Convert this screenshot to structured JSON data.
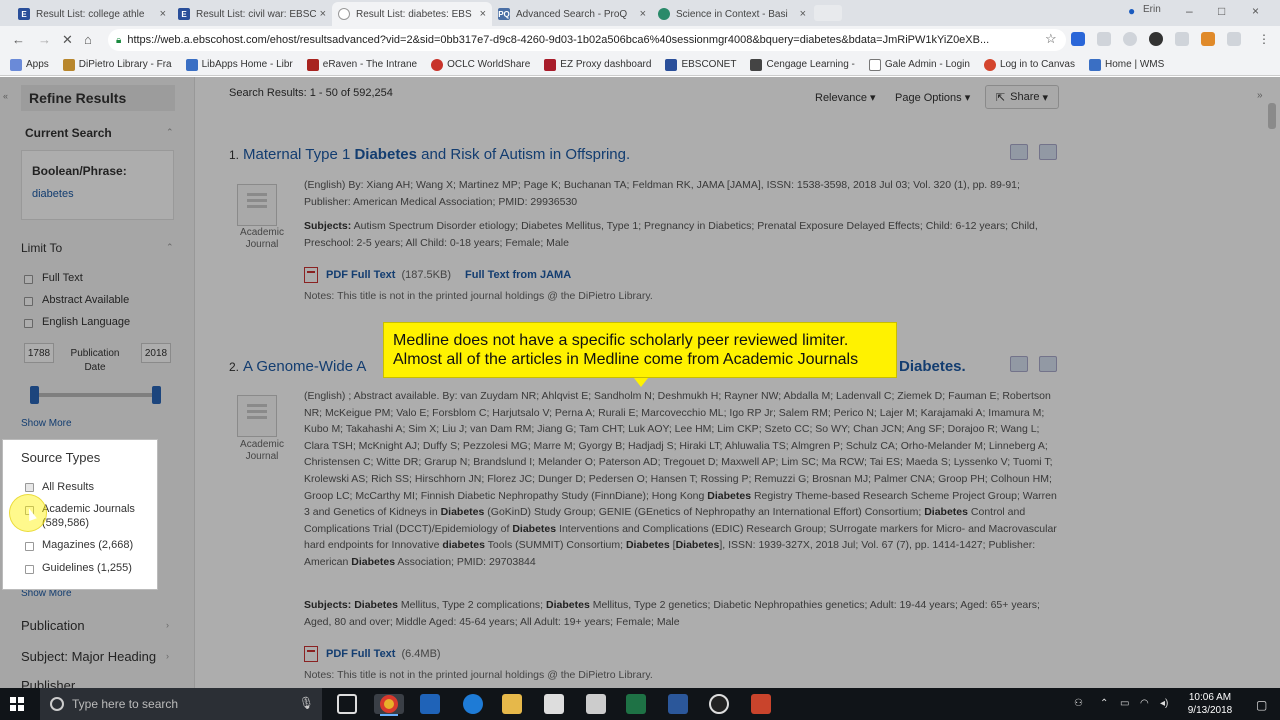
{
  "browser": {
    "tabs": [
      {
        "title": "Result List: college athle",
        "icon": "ebsco-icon",
        "color": "#2a4f9a",
        "active": false
      },
      {
        "title": "Result List: civil war: EBSC",
        "icon": "ebsco-icon",
        "color": "#2a4f9a",
        "active": false
      },
      {
        "title": "Result List: diabetes: EBS",
        "icon": "loading-icon",
        "color": "#888888",
        "active": true
      },
      {
        "title": "Advanced Search - ProQ",
        "icon": "proquest-icon",
        "color": "#4a6fa5",
        "active": false
      },
      {
        "title": "Science in Context - Basi",
        "icon": "gale-icon",
        "color": "#2a8a6a",
        "active": false
      }
    ],
    "user_label": "Erin",
    "url": "https://web.a.ebscohost.com/ehost/resultsadvanced?vid=2&sid=0bb317e7-d9c8-4260-9d03-1b02a506bca6%40sessionmgr4008&bquery=diabetes&bdata=JmRiPW1kYiZ0eXB..."
  },
  "bookmarks": [
    {
      "label": "Apps",
      "color": "#6a8ad8"
    },
    {
      "label": "DiPietro Library - Fra",
      "color": "#b8862c"
    },
    {
      "label": "LibApps Home - Libr",
      "color": "#3a6fc4"
    },
    {
      "label": "eRaven - The Intrane",
      "color": "#a8231f"
    },
    {
      "label": "OCLC WorldShare",
      "color": "#c8332a"
    },
    {
      "label": "EZ Proxy dashboard",
      "color": "#a81c2a"
    },
    {
      "label": "EBSCONET",
      "color": "#2a4f9a"
    },
    {
      "label": "Cengage Learning - ",
      "color": "#444444"
    },
    {
      "label": "Gale Admin - Login",
      "color": "#777777"
    },
    {
      "label": "Log in to Canvas",
      "color": "#d4452d"
    },
    {
      "label": "Home | WMS",
      "color": "#3a6fc4"
    }
  ],
  "sidebar": {
    "refine_title": "Refine Results",
    "current_search": "Current Search",
    "boolean_label": "Boolean/Phrase:",
    "boolean_value": "diabetes",
    "limit_to": "Limit To",
    "limiters": [
      "Full Text",
      "Abstract Available",
      "English Language"
    ],
    "year_from": "1788",
    "year_to": "2018",
    "pub_date_label": "Publication Date",
    "show_more": "Show More",
    "show_more_2": "Show More",
    "publication": "Publication",
    "subject_major": "Subject: Major Heading",
    "publisher": "Publisher"
  },
  "source_types": {
    "title": "Source Types",
    "items": [
      {
        "label": "All Results"
      },
      {
        "label": "Academic Journals (589,586)"
      },
      {
        "label": "Magazines (2,668)"
      },
      {
        "label": "Guidelines (1,255)"
      }
    ]
  },
  "results_header": {
    "count": "Search Results: 1 - 50 of 592,254",
    "relevance": "Relevance",
    "page_options": "Page Options",
    "share": "Share"
  },
  "results": [
    {
      "num": "1.",
      "title_before": "Maternal Type 1 ",
      "title_bold": "Diabetes",
      "title_after": " and Risk of Autism in Offspring.",
      "doctype": "Academic Journal",
      "citation": "(English) By: Xiang AH; Wang X; Martinez MP; Page K; Buchanan TA; Feldman RK, JAMA [JAMA], ISSN: 1538-3598, 2018 Jul 03; Vol. 320 (1), pp. 89-91; Publisher: American Medical Association; PMID: 29936530",
      "subjects_label": "Subjects:",
      "subjects": "Autism Spectrum Disorder etiology; Diabetes Mellitus, Type 1; Pregnancy in Diabetics; Prenatal Exposure Delayed Effects; Child: 6-12 years; Child, Preschool: 2-5 years; All Child: 0-18 years; Female; Male",
      "pdf_link": "PDF Full Text",
      "pdf_size": "(187.5KB)",
      "extra_link": "Full Text from JAMA",
      "notes": "Notes:  This title is not in the printed journal holdings @ the DiPietro Library."
    },
    {
      "num": "2.",
      "title_before": "A Genome-Wide A",
      "title_bold": "Diabetes.",
      "title_after": "",
      "doctype": "Academic Journal",
      "citation": "(English) ; Abstract available. By: van Zuydam NR; Ahlqvist E; Sandholm N; Deshmukh H; Rayner NW; Abdalla M; Ladenvall C; Ziemek D; Fauman E; Robertson NR; McKeigue PM; Valo E; Forsblom C; Harjutsalo V; Perna A; Rurali E; Marcovecchio ML; Igo RP Jr; Salem RM; Perico N; Lajer M; Karajamaki A; Imamura M; Kubo M; Takahashi A; Sim X; Liu J; van Dam RM; Jiang G; Tam CHT; Luk AOY; Lee HM; Lim CKP; Szeto CC; So WY; Chan JCN; Ang SF; Dorajoo R; Wang L; Clara TSH; McKnight AJ; Duffy S; Pezzolesi MG; Marre M; Gyorgy B; Hadjadj S; Hiraki LT; Ahluwalia TS; Almgren P; Schulz CA; Orho-Melander M; Linneberg A; Christensen C; Witte DR; Grarup N; Brandslund I; Melander O; Paterson AD; Tregouet D; Maxwell AP; Lim SC; Ma RCW; Tai ES; Maeda S; Lyssenko V; Tuomi T; Krolewski AS; Rich SS; Hirschhorn JN; Florez JC; Dunger D; Pedersen O; Hansen T; Rossing P; Remuzzi G; Brosnan MJ; Palmer CNA; Groop PH; Colhoun HM; Groop LC; McCarthy MI; Finnish Diabetic Nephropathy Study (FinnDiane); Hong Kong ",
      "citation_b1": "Diabetes",
      "citation_2": " Registry Theme-based Research Scheme Project Group; Warren 3 and Genetics of Kidneys in ",
      "citation_b2": "Diabetes",
      "citation_3": " (GoKinD) Study Group; GENIE (GEnetics of Nephropathy an International Effort) Consortium; ",
      "citation_b3": "Diabetes",
      "citation_4": " Control and Complications Trial (DCCT)/Epidemiology of ",
      "citation_b4": "Diabetes",
      "citation_5": " Interventions and Complications (EDIC) Research Group; SUrrogate markers for Micro- and Macrovascular hard endpoints for Innovative ",
      "citation_b5": "diabetes",
      "citation_6": " Tools (SUMMIT) Consortium; ",
      "citation_b6": "Diabetes",
      "citation_7": " [",
      "citation_b7": "Diabetes",
      "citation_8": "], ISSN: 1939-327X, 2018 Jul; Vol. 67 (7), pp. 1414-1427; Publisher: American ",
      "citation_b8": "Diabetes",
      "citation_9": " Association; PMID: 29703844",
      "subjects_label": "Subjects:",
      "subj_b1": "Diabetes",
      "subj_1": " Mellitus, Type 2 complications; ",
      "subj_b2": "Diabetes",
      "subj_2": " Mellitus, Type 2 genetics; Diabetic Nephropathies genetics; Adult: 19-44 years; Aged: 65+ years; Aged, 80 and over; Middle Aged: 45-64 years; All Adult: 19+ years; Female; Male",
      "pdf_link": "PDF Full Text",
      "pdf_size": "(6.4MB)",
      "notes": "Notes:  This title is not in the printed journal holdings @ the DiPietro Library."
    }
  ],
  "callout": {
    "line1": "Medline does not have a specific scholarly peer reviewed limiter.",
    "line2": "Almost all of the articles in Medline come from Academic Journals"
  },
  "taskbar": {
    "search_placeholder": "Type here to search",
    "time": "10:06 AM",
    "date": "9/13/2018"
  }
}
